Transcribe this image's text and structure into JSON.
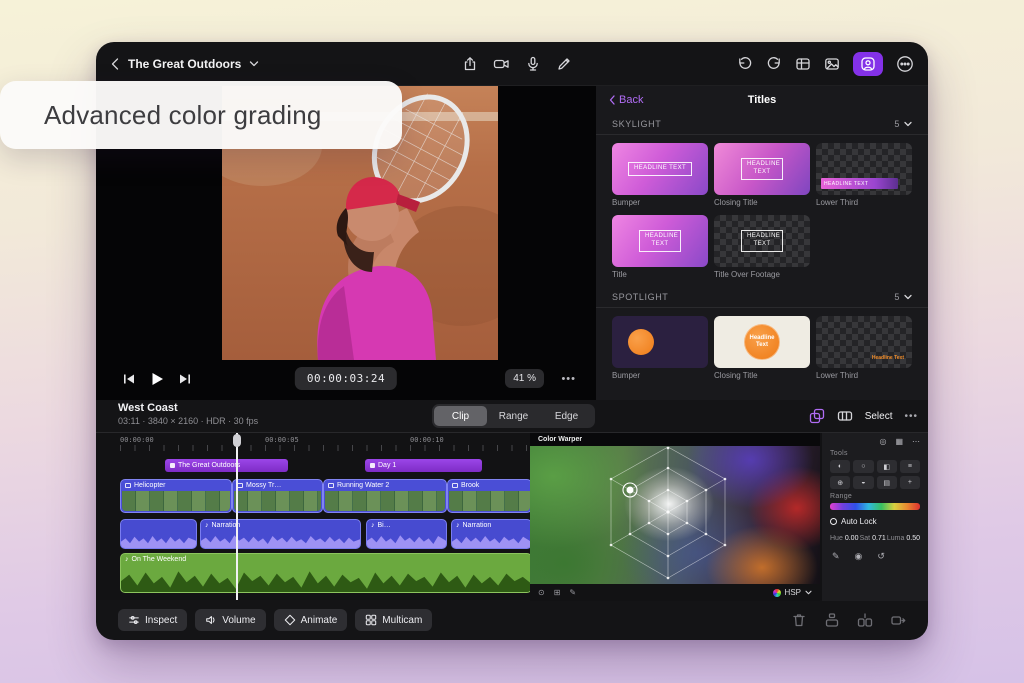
{
  "callout": {
    "label": "Advanced color grading"
  },
  "titlebar": {
    "project_title": "The Great Outdoors"
  },
  "player": {
    "timecode": "00:00:03:24",
    "zoom_level": "41 %",
    "more": "•••"
  },
  "titles_panel": {
    "back_label": "Back",
    "title": "Titles",
    "sections": [
      {
        "name": "SKYLIGHT",
        "count": "5",
        "items": [
          {
            "label": "Bumper",
            "preview_text": "HEADLINE TEXT"
          },
          {
            "label": "Closing Title",
            "preview_text": "HEADLINE TEXT"
          },
          {
            "label": "Lower Third",
            "preview_text": "HEADLINE TEXT"
          },
          {
            "label": "Title",
            "preview_text": "HEADLINE TEXT"
          },
          {
            "label": "Title Over Footage",
            "preview_text": "HEADLINE TEXT"
          }
        ]
      },
      {
        "name": "SPOTLIGHT",
        "count": "5",
        "items": [
          {
            "label": "Bumper",
            "preview_text": ""
          },
          {
            "label": "Closing Title",
            "preview_text": "Headline Text"
          },
          {
            "label": "Lower Third",
            "preview_text": "Headline Text"
          }
        ]
      }
    ]
  },
  "timeline": {
    "project_name": "West Coast",
    "project_meta": "03:11 · 3840 × 2160 · HDR · 30 fps",
    "segments": [
      {
        "label": "Clip"
      },
      {
        "label": "Range"
      },
      {
        "label": "Edge"
      }
    ],
    "select_label": "Select",
    "more": "•••",
    "ruler_labels": [
      {
        "t": "00:00:00"
      },
      {
        "t": "00:00:05"
      },
      {
        "t": "00:00:10"
      }
    ],
    "markers": [
      {
        "label": "The Great Outdoors"
      },
      {
        "label": "Day 1"
      }
    ],
    "video_clips": [
      {
        "label": "Helicopter"
      },
      {
        "label": "Mossy Tr…"
      },
      {
        "label": "Running Water 2"
      },
      {
        "label": "Brook"
      }
    ],
    "audio_clips": [
      {
        "label": "Narration"
      },
      {
        "label": "Bi…"
      },
      {
        "label": "Narration"
      }
    ],
    "music_clip": {
      "label": "On The Weekend"
    }
  },
  "color_warper": {
    "title": "Color Warper",
    "mode": "HSP",
    "tools_label": "Tools",
    "range_label": "Range",
    "auto_lock_label": "Auto Lock",
    "values": [
      {
        "label": "Hue",
        "value": "0.00"
      },
      {
        "label": "Sat",
        "value": "0.71"
      },
      {
        "label": "Luma",
        "value": "0.50"
      }
    ]
  },
  "bottom_toolbar": {
    "buttons": [
      {
        "label": "Inspect"
      },
      {
        "label": "Volume"
      },
      {
        "label": "Animate"
      },
      {
        "label": "Multicam"
      }
    ]
  }
}
